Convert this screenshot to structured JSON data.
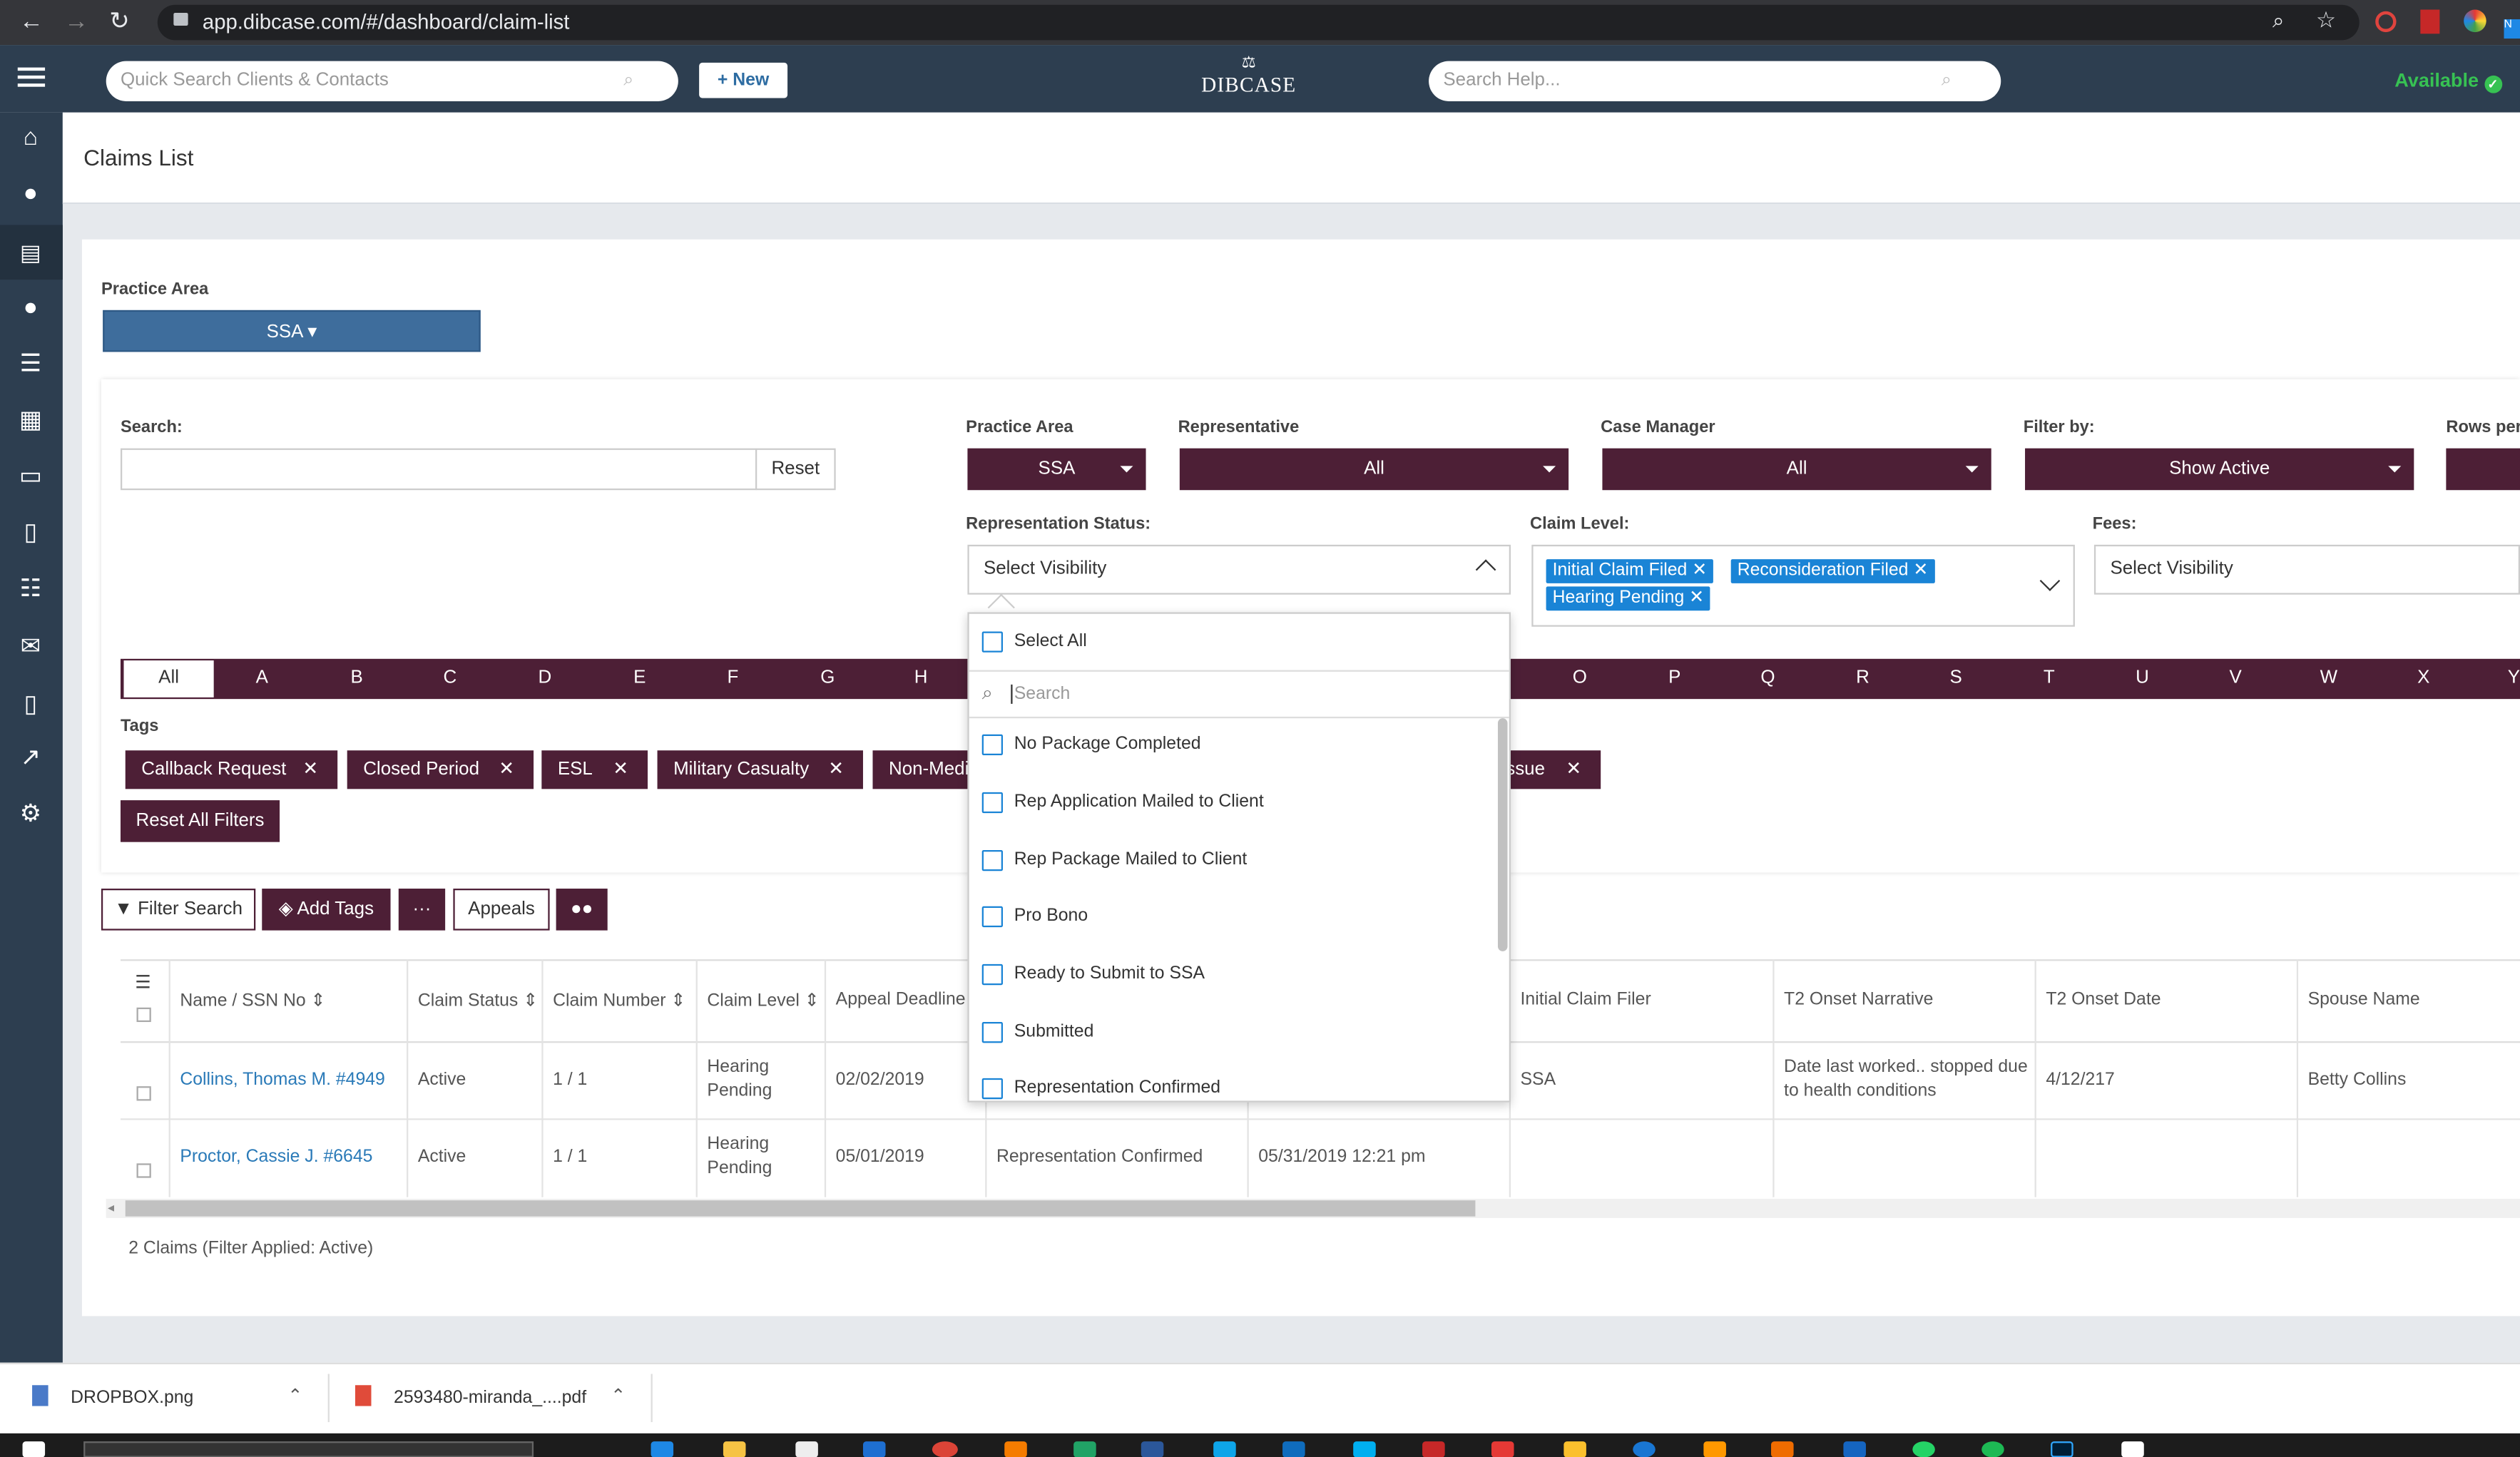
{
  "browser": {
    "url": "app.dibcase.com/#/dashboard/claim-list"
  },
  "header": {
    "quick_search_placeholder": "Quick Search Clients & Contacts",
    "new_label": "+ New",
    "logo": "DIBCASE",
    "help_placeholder": "Search Help...",
    "status": "Available"
  },
  "page": {
    "title": "Claims List"
  },
  "practice_area": {
    "label": "Practice Area",
    "value": "SSA ▾"
  },
  "filters": {
    "search_label": "Search:",
    "reset": "Reset",
    "practice_area_label": "Practice Area",
    "practice_area_value": "SSA",
    "representative_label": "Representative",
    "representative_value": "All",
    "case_manager_label": "Case Manager",
    "case_manager_value": "All",
    "filter_by_label": "Filter by:",
    "filter_by_value": "Show Active",
    "rows_per_label": "Rows per",
    "rep_status_label": "Representation Status:",
    "rep_status_value": "Select Visibility",
    "claim_level_label": "Claim Level:",
    "claim_level_chips": [
      "Initial Claim Filed",
      "Reconsideration Filed",
      "Hearing Pending"
    ],
    "fees_label": "Fees:",
    "fees_value": "Select Visibility"
  },
  "alphabet": [
    "All",
    "A",
    "B",
    "C",
    "D",
    "E",
    "F",
    "G",
    "H",
    "O",
    "P",
    "Q",
    "R",
    "S",
    "T",
    "U",
    "V",
    "W",
    "X",
    "Y"
  ],
  "tags": {
    "label": "Tags",
    "items": [
      "Callback Request",
      "Closed Period",
      "ESL",
      "Military Casualty",
      "Non-Medi",
      "ssue"
    ],
    "reset_all": "Reset All Filters"
  },
  "actions": {
    "filter_search": "Filter Search",
    "add_tags": "Add Tags",
    "more": "···",
    "appeals": "Appeals"
  },
  "table": {
    "headers": [
      "Name / SSN No",
      "Claim Status",
      "Claim Number",
      "Claim Level",
      "Appeal Deadline",
      "Initial Claim Filer",
      "T2 Onset Narrative",
      "T2 Onset Date",
      "Spouse Name"
    ],
    "rows": [
      {
        "name": "Collins, Thomas M. #4949",
        "status": "Active",
        "number": "1 / 1",
        "level1": "Hearing",
        "level2": "Pending",
        "deadline": "02/02/2019",
        "filer": "SSA",
        "narr1": "Date last worked.. stopped due",
        "narr2": "to health conditions",
        "onset": "4/12/217",
        "spouse": "Betty Collins",
        "rep": "",
        "date": ""
      },
      {
        "name": "Proctor, Cassie J. #6645",
        "status": "Active",
        "number": "1 / 1",
        "level1": "Hearing",
        "level2": "Pending",
        "deadline": "05/01/2019",
        "filer": "",
        "narr1": "",
        "narr2": "",
        "onset": "",
        "spouse": "",
        "rep": "Representation Confirmed",
        "date": "05/31/2019 12:21 pm"
      }
    ],
    "footer": "2 Claims (Filter Applied: Active)"
  },
  "dropdown": {
    "select_all": "Select All",
    "search_placeholder": "Search",
    "options": [
      "No Package Completed",
      "Rep Application Mailed to Client",
      "Rep Package Mailed to Client",
      "Pro Bono",
      "Ready to Submit to SSA",
      "Submitted",
      "Representation Confirmed"
    ]
  },
  "downloads": [
    {
      "name": "DROPBOX.png"
    },
    {
      "name": "2593480-miranda_....pdf"
    }
  ],
  "colors": {
    "brand": "#2d3e50",
    "accent": "#4d1f36",
    "chip": "#1a84d6",
    "available": "#37c253"
  }
}
